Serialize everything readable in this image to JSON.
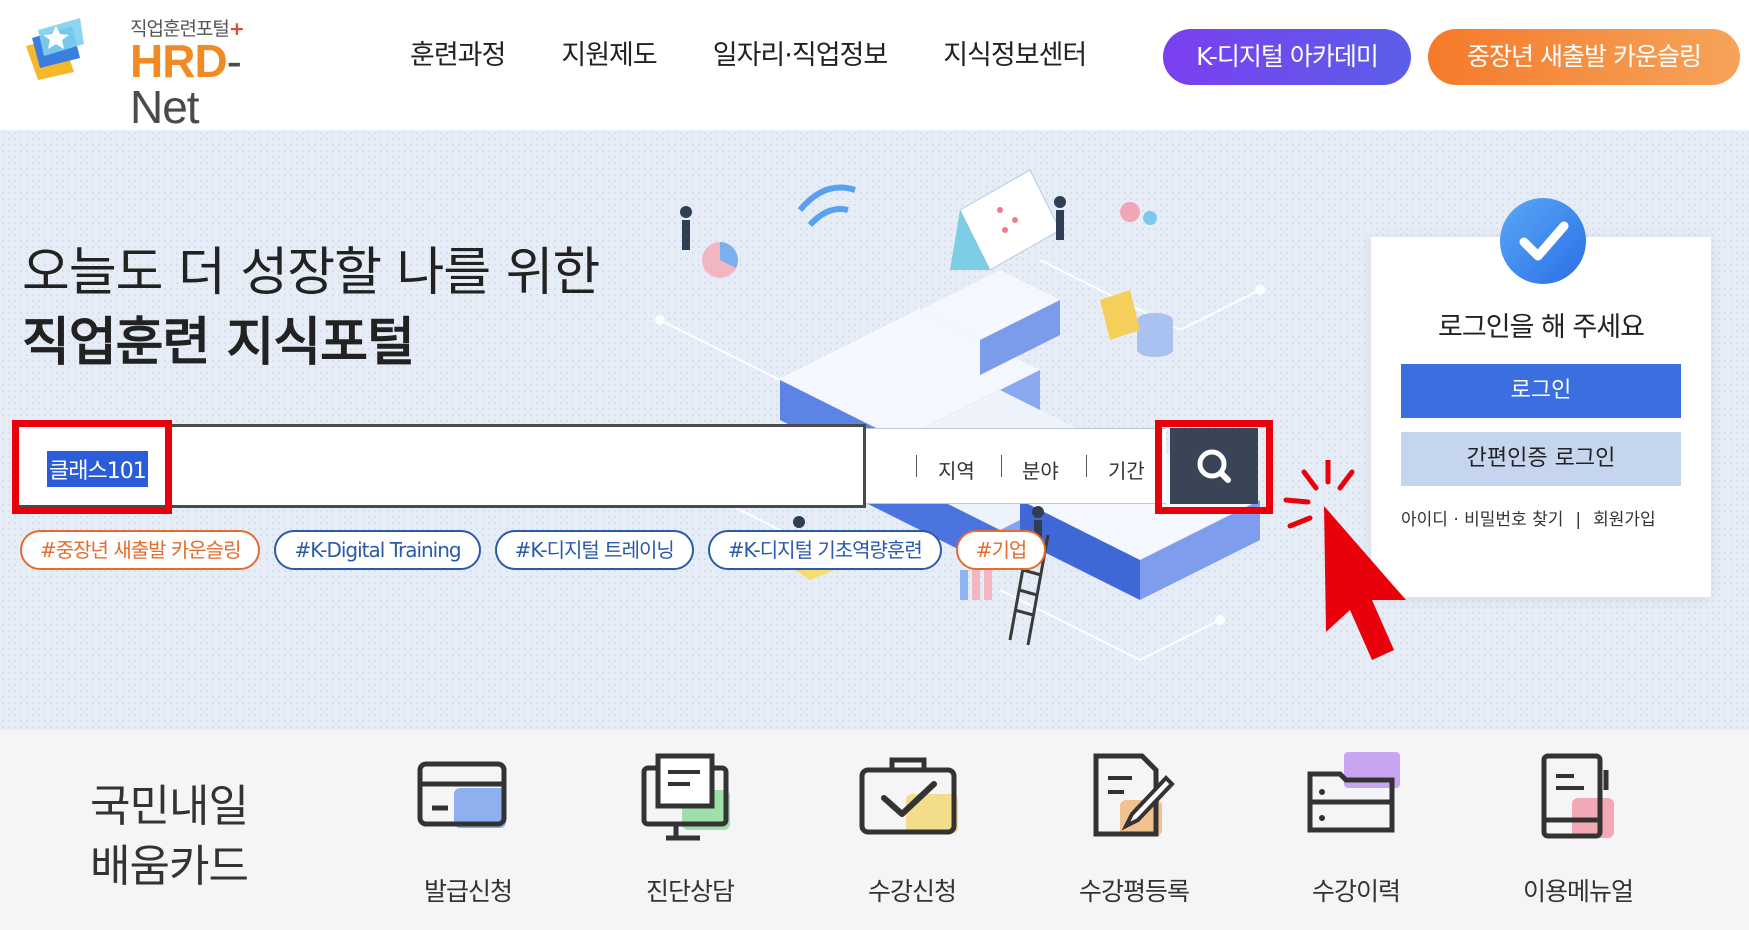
{
  "header": {
    "logo_sub": "직업훈련포털",
    "logo_plus": "+",
    "logo_hrd": "HRD",
    "logo_net": "- Net",
    "nav": [
      "훈련과정",
      "지원제도",
      "일자리·직업정보",
      "지식정보센터"
    ],
    "academy_button": "K-디지털 아카데미",
    "counseling_button": "중장년 새출발 카운슬링",
    "colors": {
      "purple": "#7b3ff0",
      "orange": "#f57a2a"
    }
  },
  "hero": {
    "headline_line1": "오늘도 더 성장할 나를 위한",
    "headline_line2": "직업훈련 지식포털",
    "search": {
      "value": "클래스101",
      "filters": [
        "지역",
        "분야",
        "기간"
      ],
      "button_icon": "search-icon"
    },
    "tags": [
      {
        "label": "#중장년 새출발 카운슬링",
        "color": "orange"
      },
      {
        "label": "#K-Digital Training",
        "color": "blue"
      },
      {
        "label": "#K-디지털 트레이닝",
        "color": "blue"
      },
      {
        "label": "#K-디지털 기초역량훈련",
        "color": "blue"
      },
      {
        "label": "#기업",
        "color": "orange"
      }
    ]
  },
  "login": {
    "title": "로그인을 해 주세요",
    "login_button": "로그인",
    "easy_login_button": "간편인증 로그인",
    "find_account": "아이디 · 비밀번호 찾기",
    "separator": "|",
    "signup": "회원가입",
    "icon": "check-circle-icon"
  },
  "card_section": {
    "title_line1": "국민내일",
    "title_line2": "배움카드",
    "items": [
      {
        "label": "발급신청",
        "icon": "card-icon",
        "accent": "#8fb0ef"
      },
      {
        "label": "진단상담",
        "icon": "monitor-document-icon",
        "accent": "#9ee0a8"
      },
      {
        "label": "수강신청",
        "icon": "briefcase-check-icon",
        "accent": "#f3dc8a"
      },
      {
        "label": "수강평등록",
        "icon": "document-pen-icon",
        "accent": "#f0c28f"
      },
      {
        "label": "수강이력",
        "icon": "folder-cabinet-icon",
        "accent": "#c8a5f0"
      },
      {
        "label": "이용메뉴얼",
        "icon": "manual-book-icon",
        "accent": "#f3a9b5"
      }
    ]
  }
}
